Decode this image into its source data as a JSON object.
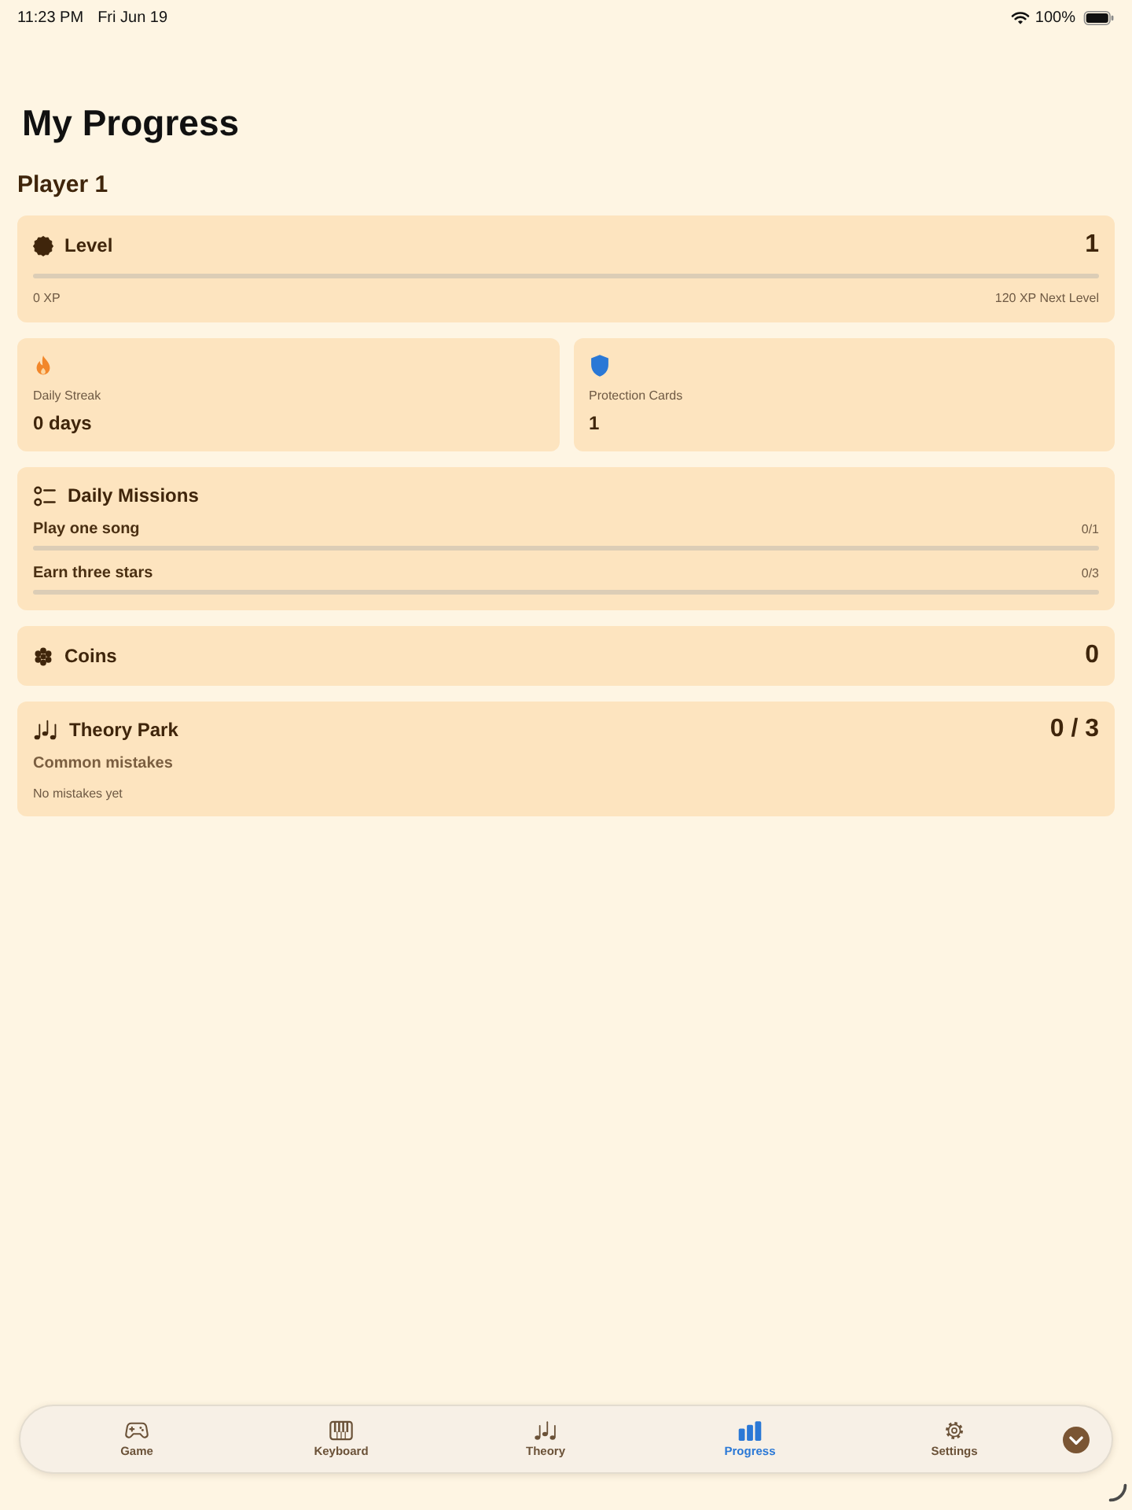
{
  "status_bar": {
    "time": "11:23 PM",
    "date": "Fri Jun 19",
    "battery": "100%"
  },
  "title": "My Progress",
  "player": "Player 1",
  "level_card": {
    "label": "Level",
    "value": "1",
    "current_xp": "0 XP",
    "next_level": "120 XP Next Level"
  },
  "stats": [
    {
      "kind": "streak",
      "label": "Daily Streak",
      "value": "0 days"
    },
    {
      "kind": "protection",
      "label": "Protection Cards",
      "value": "1"
    }
  ],
  "missions": {
    "title": "Daily Missions",
    "items": [
      {
        "name": "Play one song",
        "count": "0/1"
      },
      {
        "name": "Earn three stars",
        "count": "0/3"
      }
    ]
  },
  "coins": {
    "label": "Coins",
    "value": "0"
  },
  "theory": {
    "label": "Theory Park",
    "value": "0 / 3",
    "subtitle": "Common mistakes",
    "note": "No mistakes yet"
  },
  "tab_bar": {
    "tabs": [
      {
        "kind": "game",
        "label": "Game",
        "selected": false
      },
      {
        "kind": "keyboard",
        "label": "Keyboard",
        "selected": false
      },
      {
        "kind": "theory",
        "label": "Theory",
        "selected": false
      },
      {
        "kind": "progress",
        "label": "Progress",
        "selected": true
      },
      {
        "kind": "settings",
        "label": "Settings",
        "selected": false
      }
    ]
  }
}
